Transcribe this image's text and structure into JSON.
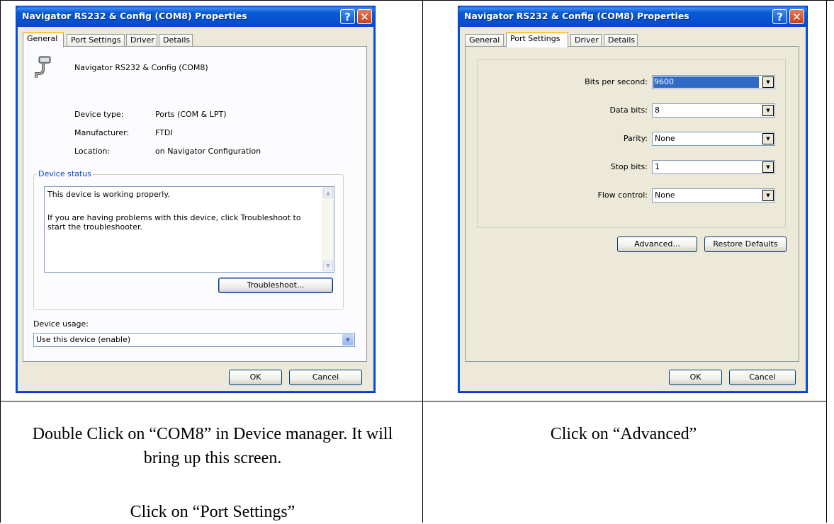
{
  "left_dialog": {
    "title": "Navigator RS232 & Config (COM8) Properties",
    "tabs": [
      "General",
      "Port Settings",
      "Driver",
      "Details"
    ],
    "device_name": "Navigator RS232 & Config (COM8)",
    "props": [
      {
        "label": "Device type:",
        "value": "Ports (COM & LPT)"
      },
      {
        "label": "Manufacturer:",
        "value": "FTDI"
      },
      {
        "label": "Location:",
        "value": "on Navigator Configuration"
      }
    ],
    "status_group": "Device status",
    "status_line1": "This device is working properly.",
    "status_line2": "If you are having problems with this device, click Troubleshoot to start the troubleshooter.",
    "troubleshoot": "Troubleshoot...",
    "usage_label": "Device usage:",
    "usage_value": "Use this device (enable)",
    "ok": "OK",
    "cancel": "Cancel"
  },
  "right_dialog": {
    "title": "Navigator RS232 & Config (COM8) Properties",
    "tabs": [
      "General",
      "Port Settings",
      "Driver",
      "Details"
    ],
    "fields": [
      {
        "label": "Bits per second:",
        "value": "9600"
      },
      {
        "label": "Data bits:",
        "value": "8"
      },
      {
        "label": "Parity:",
        "value": "None"
      },
      {
        "label": "Stop bits:",
        "value": "1"
      },
      {
        "label": "Flow control:",
        "value": "None"
      }
    ],
    "advanced": "Advanced...",
    "restore": "Restore Defaults",
    "ok": "OK",
    "cancel": "Cancel"
  },
  "captions": {
    "left_1": "Double Click on “COM8” in Device manager.  It will bring up this screen.",
    "left_2": "Click on “Port Settings”",
    "right_1": "Click on “Advanced”"
  },
  "icons": {
    "help": "?",
    "close": "✕",
    "dropdown": "▼",
    "scroll_up": "▲",
    "scroll_down": "▼"
  }
}
